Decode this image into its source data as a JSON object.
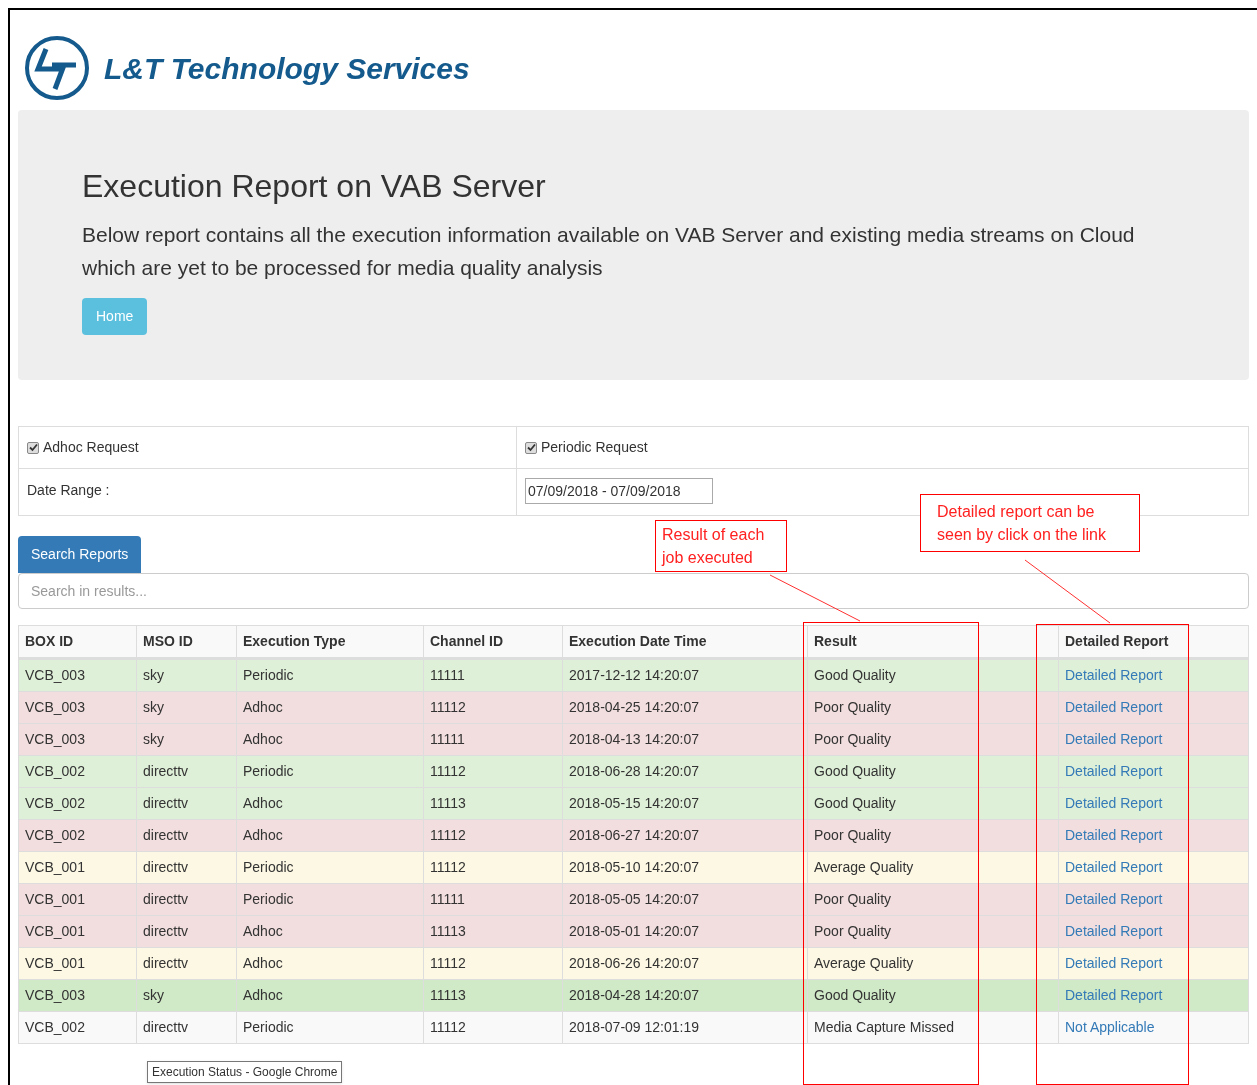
{
  "brand": {
    "name": "L&T Technology Services"
  },
  "hero": {
    "title": "Execution Report on VAB Server",
    "description": "Below report contains all the execution information available on VAB Server and existing media streams on Cloud which are yet to be processed for media quality analysis",
    "button": "Home"
  },
  "filters": {
    "options": [
      {
        "label": "Adhoc Request",
        "checked": true
      },
      {
        "label": "Periodic Request",
        "checked": true
      }
    ],
    "date_label": "Date Range :",
    "date_value": "07/09/2018 - 07/09/2018"
  },
  "search_button": "Search Reports",
  "search": {
    "placeholder": "Search in results..."
  },
  "table": {
    "columns": [
      "BOX ID",
      "MSO ID",
      "Execution Type",
      "Channel ID",
      "Execution Date Time",
      "Result",
      "Detailed Report"
    ],
    "rows": [
      {
        "cells": [
          "VCB_003",
          "sky",
          "Periodic",
          "11111",
          "2017-12-12 14:20:07",
          "Good Quality"
        ],
        "link": "Detailed Report",
        "color": "#dff0d8"
      },
      {
        "cells": [
          "VCB_003",
          "sky",
          "Adhoc",
          "11112",
          "2018-04-25 14:20:07",
          "Poor Quality"
        ],
        "link": "Detailed Report",
        "color": "#f2dede"
      },
      {
        "cells": [
          "VCB_003",
          "sky",
          "Adhoc",
          "11111",
          "2018-04-13 14:20:07",
          "Poor Quality"
        ],
        "link": "Detailed Report",
        "color": "#f2dede"
      },
      {
        "cells": [
          "VCB_002",
          "directtv",
          "Periodic",
          "11112",
          "2018-06-28 14:20:07",
          "Good Quality"
        ],
        "link": "Detailed Report",
        "color": "#dff0d8"
      },
      {
        "cells": [
          "VCB_002",
          "directtv",
          "Adhoc",
          "11113",
          "2018-05-15 14:20:07",
          "Good Quality"
        ],
        "link": "Detailed Report",
        "color": "#dff0d8"
      },
      {
        "cells": [
          "VCB_002",
          "directtv",
          "Adhoc",
          "11112",
          "2018-06-27 14:20:07",
          "Poor Quality"
        ],
        "link": "Detailed Report",
        "color": "#f2dede"
      },
      {
        "cells": [
          "VCB_001",
          "directtv",
          "Periodic",
          "11112",
          "2018-05-10 14:20:07",
          "Average Quality"
        ],
        "link": "Detailed Report",
        "color": "#fcf8e3"
      },
      {
        "cells": [
          "VCB_001",
          "directtv",
          "Periodic",
          "11111",
          "2018-05-05 14:20:07",
          "Poor Quality"
        ],
        "link": "Detailed Report",
        "color": "#f2dede"
      },
      {
        "cells": [
          "VCB_001",
          "directtv",
          "Adhoc",
          "11113",
          "2018-05-01 14:20:07",
          "Poor Quality"
        ],
        "link": "Detailed Report",
        "color": "#f2dede"
      },
      {
        "cells": [
          "VCB_001",
          "directtv",
          "Adhoc",
          "11112",
          "2018-06-26 14:20:07",
          "Average Quality"
        ],
        "link": "Detailed Report",
        "color": "#fcf8e3"
      },
      {
        "cells": [
          "VCB_003",
          "sky",
          "Adhoc",
          "11113",
          "2018-04-28 14:20:07",
          "Good Quality"
        ],
        "link": "Detailed Report",
        "color": "#d0e9c6"
      },
      {
        "cells": [
          "VCB_002",
          "directtv",
          "Periodic",
          "11112",
          "2018-07-09 12:01:19",
          "Media Capture Missed"
        ],
        "link": "Not Applicable",
        "color": "#f9f9f9"
      }
    ]
  },
  "tooltip": "Execution Status - Google Chrome",
  "annotations": [
    {
      "text": "Result of each job executed"
    },
    {
      "text": "Detailed report can be seen by click on the link"
    }
  ]
}
